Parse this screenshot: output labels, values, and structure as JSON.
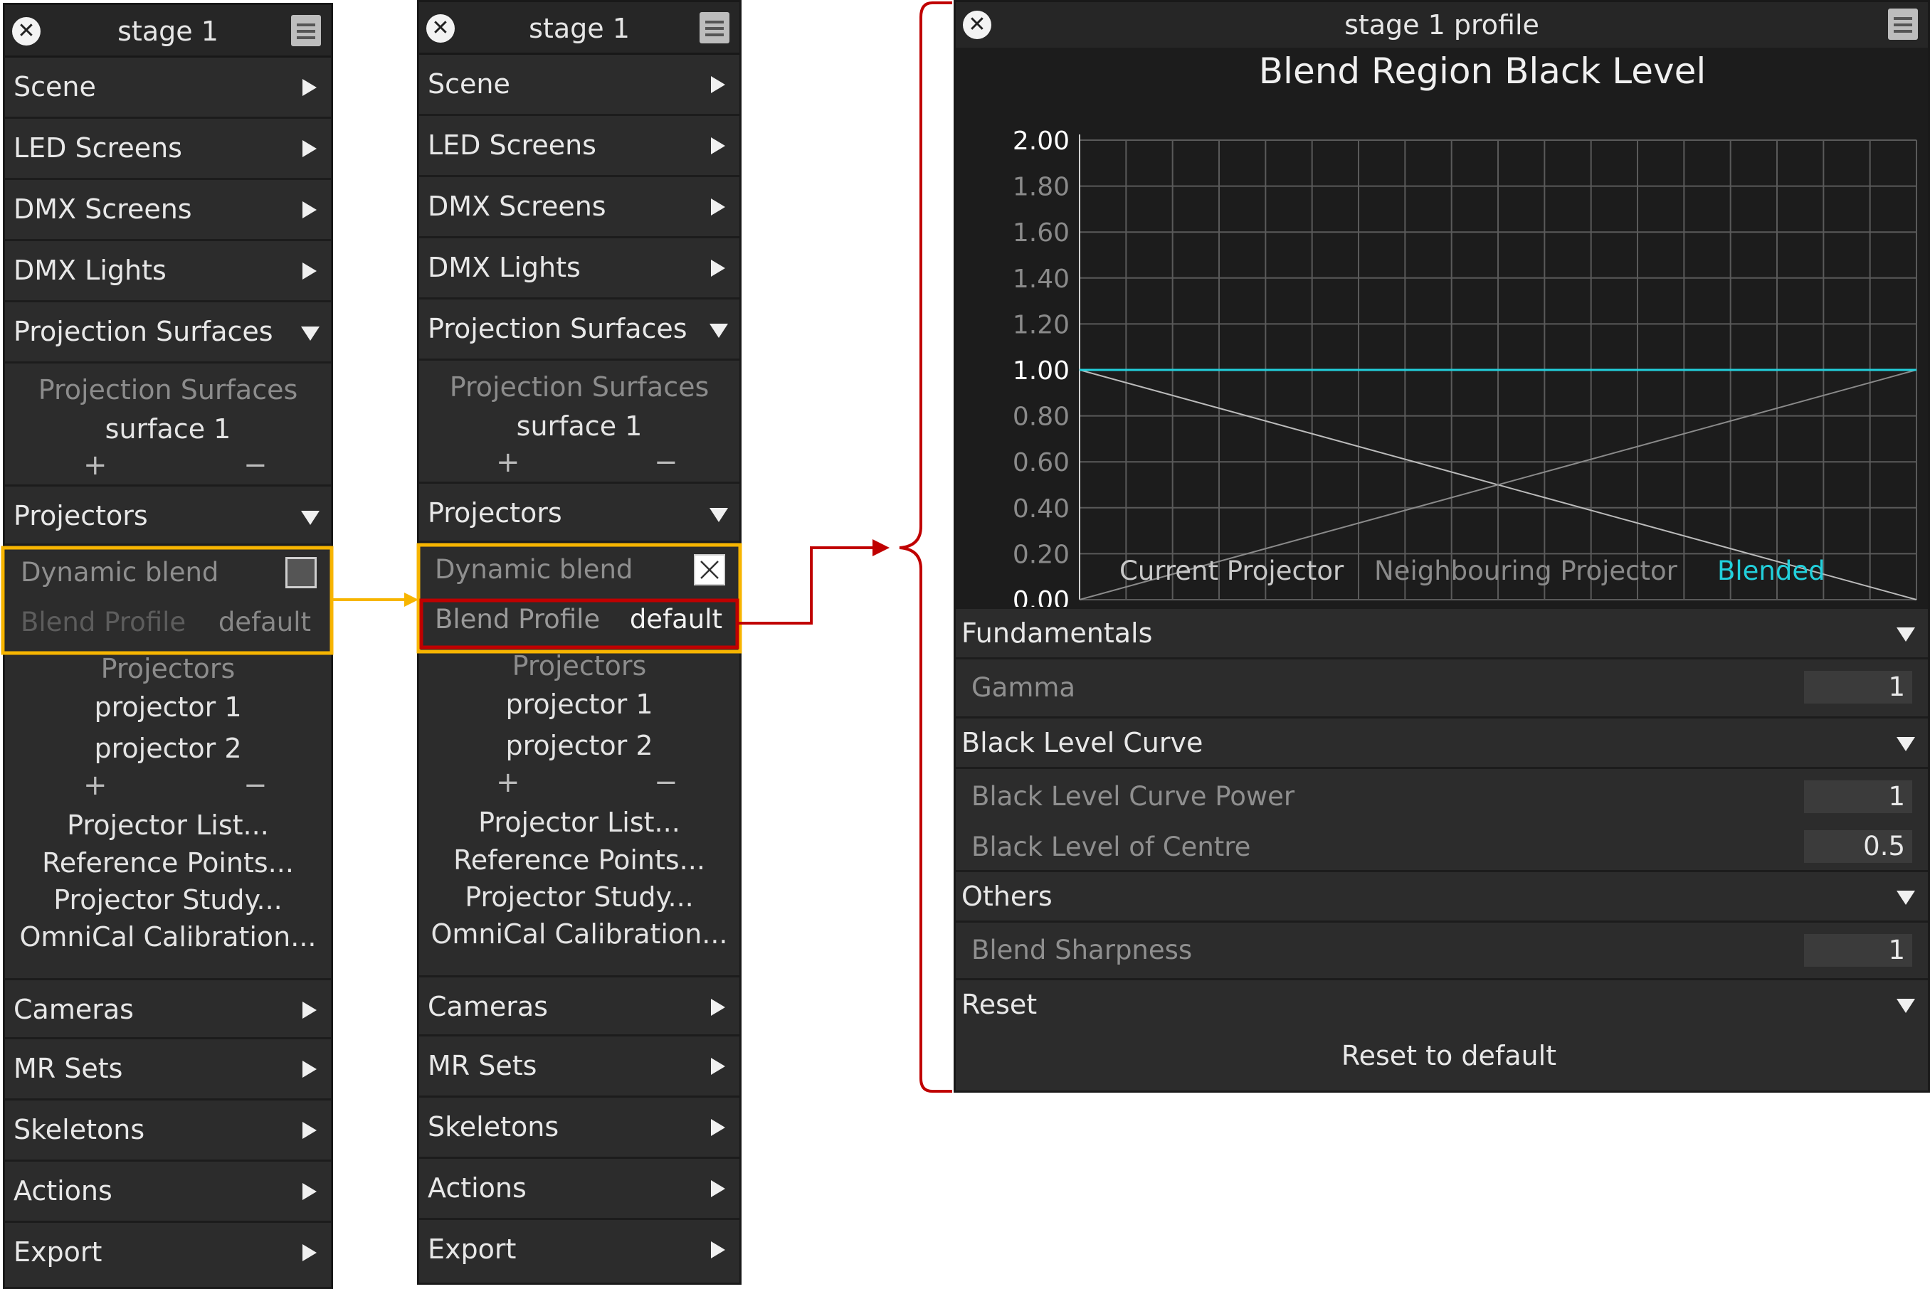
{
  "stage_panel": {
    "title": "stage 1",
    "menu": [
      {
        "label": "Scene"
      },
      {
        "label": "LED Screens"
      },
      {
        "label": "DMX Screens"
      },
      {
        "label": "DMX Lights"
      }
    ],
    "projection_surfaces": {
      "label": "Projection Surfaces",
      "list_header": "Projection Surfaces",
      "items": [
        "surface 1"
      ],
      "add": "+",
      "remove": "−"
    },
    "projectors": {
      "label": "Projectors",
      "dynamic_blend_label": "Dynamic blend",
      "blend_profile_label": "Blend Profile",
      "blend_profile_value": "default",
      "list_header": "Projectors",
      "items": [
        "projector 1",
        "projector 2"
      ],
      "add": "+",
      "remove": "−",
      "links": [
        "Projector List...",
        "Reference Points...",
        "Projector Study...",
        "OmniCal Calibration..."
      ]
    },
    "menu_bottom": [
      {
        "label": "Cameras"
      },
      {
        "label": "MR Sets"
      },
      {
        "label": "Skeletons"
      },
      {
        "label": "Actions"
      },
      {
        "label": "Export"
      }
    ]
  },
  "panel_states": {
    "before": {
      "dynamic_blend_checked": false
    },
    "after": {
      "dynamic_blend_checked": true
    }
  },
  "profile_panel": {
    "title": "stage 1 profile",
    "sections": {
      "fundamentals": "Fundamentals",
      "gamma_label": "Gamma",
      "gamma_value": "1",
      "black_level_curve": "Black Level Curve",
      "blc_power_label": "Black Level Curve Power",
      "blc_power_value": "1",
      "blc_centre_label": "Black Level of Centre",
      "blc_centre_value": "0.5",
      "others": "Others",
      "sharpness_label": "Blend Sharpness",
      "sharpness_value": "1",
      "reset": "Reset",
      "reset_button": "Reset to default"
    }
  },
  "chart_data": {
    "type": "line",
    "title": "Blend Region Black Level",
    "xlabel": "",
    "ylabel": "",
    "x": [
      0,
      1
    ],
    "ylim": [
      0,
      2
    ],
    "yticks": [
      "0.00",
      "0.20",
      "0.40",
      "0.60",
      "0.80",
      "1.00",
      "1.20",
      "1.40",
      "1.60",
      "1.80",
      "2.00"
    ],
    "grid": true,
    "series": [
      {
        "name": "Current Projector",
        "values": [
          1.0,
          0.0
        ],
        "color": "#bbbbbb"
      },
      {
        "name": "Neighbouring Projector",
        "values": [
          0.0,
          1.0
        ],
        "color": "#8a8a8a"
      },
      {
        "name": "Blended",
        "values": [
          1.0,
          1.0
        ],
        "color": "#22d0dc"
      }
    ]
  },
  "colors": {
    "highlight_yellow": "#f7b500",
    "highlight_red": "#c00000",
    "accent_cyan": "#22d0dc",
    "panel_bg": "#2c2c2c"
  }
}
